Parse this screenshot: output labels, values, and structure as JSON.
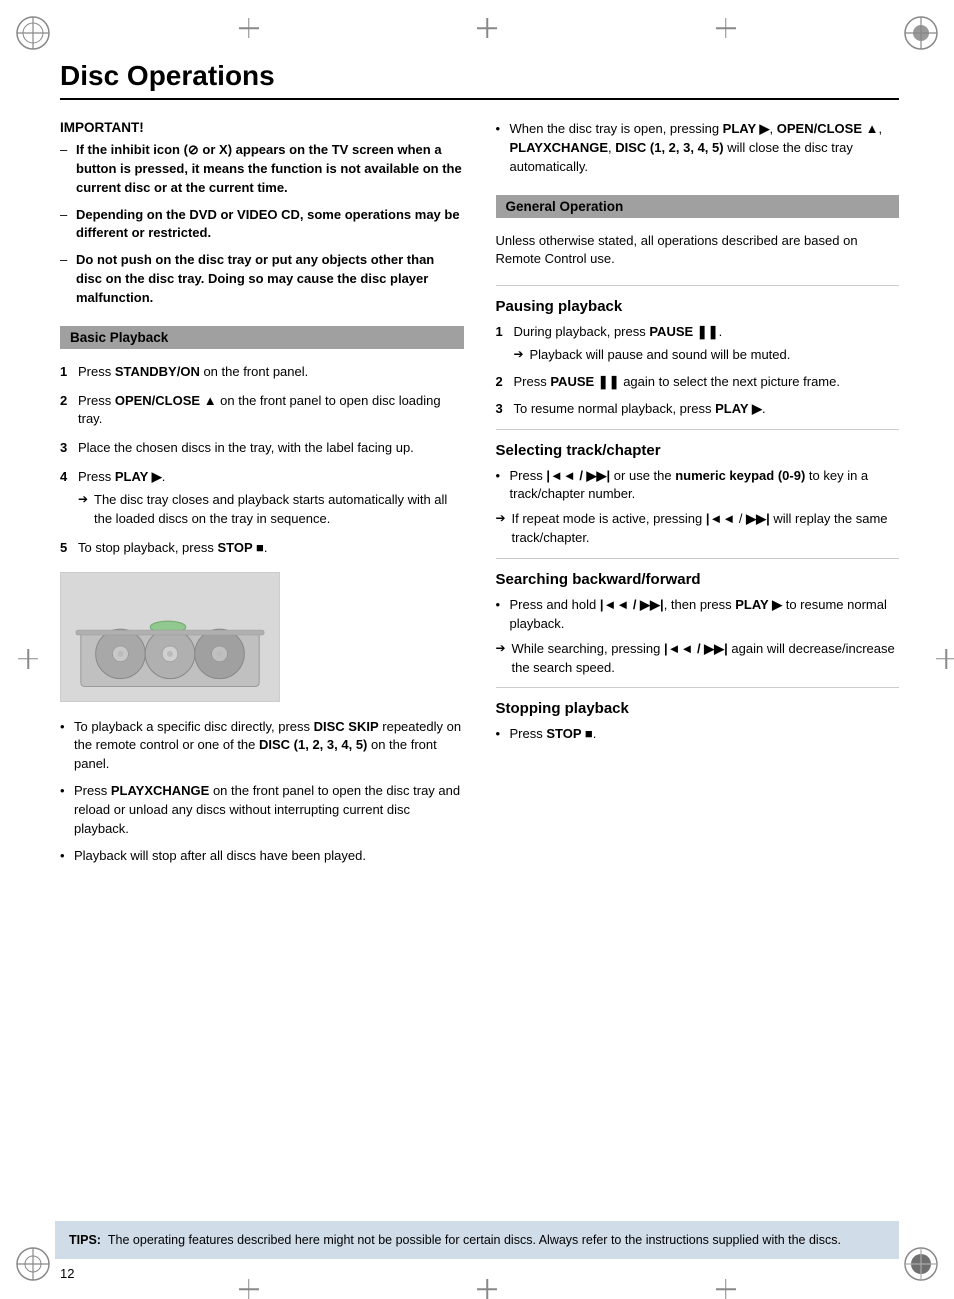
{
  "page": {
    "title": "Disc Operations",
    "page_number": "12"
  },
  "important": {
    "label": "IMPORTANT!",
    "items": [
      "If the inhibit icon (⊘ or X) appears on the TV screen when a button is pressed, it means the function is not available on the current disc or at the current time.",
      "Depending on the DVD or VIDEO CD, some operations may be different or restricted.",
      "Do not push on the disc tray or put any objects other than disc on the disc tray. Doing so may cause the disc player malfunction."
    ]
  },
  "basic_playback": {
    "header": "Basic Playback",
    "steps": [
      {
        "num": "1",
        "text": "Press STANDBY/ON on the front panel."
      },
      {
        "num": "2",
        "text": "Press OPEN/CLOSE ▲ on the front panel to open disc loading tray."
      },
      {
        "num": "3",
        "text": "Place the chosen discs in the tray, with the label facing up."
      },
      {
        "num": "4",
        "text": "Press PLAY ▶.",
        "note": "The disc tray closes and playback starts automatically with all the loaded discs on the tray in sequence."
      },
      {
        "num": "5",
        "text": "To stop playback, press STOP ■."
      }
    ],
    "bullets": [
      "To playback a specific disc directly, press DISC SKIP repeatedly on the remote control or one of the DISC (1, 2, 3, 4, 5) on the front panel.",
      "Press PLAYXCHANGE on the front panel to open the disc tray and reload or unload any discs without interrupting current disc playback.",
      "Playback will stop after all discs have been played."
    ]
  },
  "right_top": {
    "bullet": "When the disc tray is open, pressing PLAY ▶, OPEN/CLOSE ▲, PLAYXCHANGE, DISC (1, 2, 3, 4, 5) will close the disc tray automatically."
  },
  "general_operation": {
    "header": "General Operation",
    "note": "Unless otherwise stated, all operations described are based on Remote Control use."
  },
  "pausing_playback": {
    "title": "Pausing playback",
    "steps": [
      {
        "num": "1",
        "text": "During playback, press PAUSE II.",
        "note": "Playback will pause and sound will be muted."
      },
      {
        "num": "2",
        "text": "Press PAUSE II again to select the next picture frame."
      },
      {
        "num": "3",
        "text": "To resume normal playback, press PLAY ▶."
      }
    ]
  },
  "selecting_track": {
    "title": "Selecting track/chapter",
    "bullets": [
      "Press |◄◄ / ▶▶| or use the numeric keypad (0-9) to key in a track/chapter number.",
      "If repeat mode is active, pressing |◄◄ / ▶▶| will replay the same track/chapter."
    ],
    "note": "If repeat mode is active, pressing |◄◄ / ▶▶| will replay the same track/chapter."
  },
  "searching": {
    "title": "Searching backward/forward",
    "bullets": [
      "Press and hold |◄◄ / ▶▶|, then press PLAY ▶ to resume normal playback.",
      "While searching, pressing |◄◄ / ▶▶| again will decrease/increase the search speed."
    ]
  },
  "stopping_playback": {
    "title": "Stopping playback",
    "bullet": "Press STOP ■."
  },
  "tips": {
    "label": "TIPS:",
    "text": "The operating features described here might not be possible for certain discs. Always refer to the instructions supplied with the discs."
  }
}
